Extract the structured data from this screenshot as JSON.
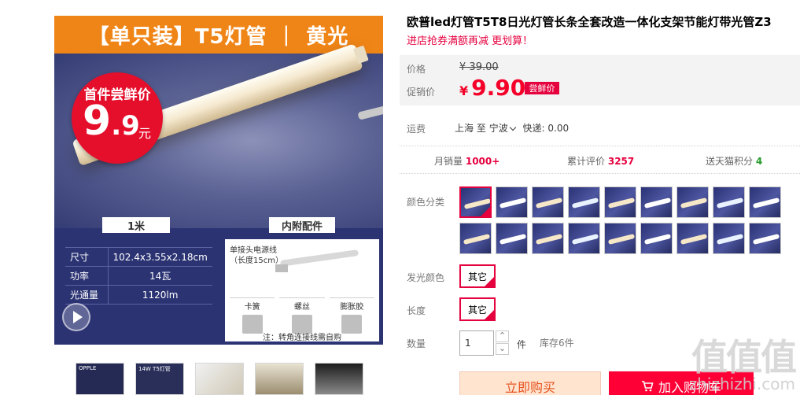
{
  "main_image": {
    "banner_left": "【单只装】T5灯管",
    "banner_sep": "|",
    "banner_right": "黄光",
    "badge_line1": "首件尝鲜价",
    "badge_price_int": "9",
    "badge_price_dec": ".9",
    "badge_unit": "元",
    "length_tag": "1米",
    "accessories_tag": "内附配件",
    "specs": [
      {
        "key": "尺寸",
        "value": "102.4x3.55x2.18cm"
      },
      {
        "key": "功率",
        "value": "14瓦"
      },
      {
        "key": "光通量",
        "value": "1120lm"
      }
    ],
    "accessory_title_1": "单接头电源线",
    "accessory_title_2": "（长度15cm）",
    "accessory_items": [
      "卡簧",
      "螺丝",
      "膨胀胶"
    ],
    "accessory_note": "注：转角连接线需自购"
  },
  "thumbnails": [
    {
      "label": "OPPLE"
    },
    {
      "label": "14W T5灯管"
    },
    {
      "label": ""
    },
    {
      "label": ""
    },
    {
      "label": ""
    }
  ],
  "product": {
    "title": "欧普led灯管T5T8日光灯管长条全套改造一体化支架节能灯带光管Z3",
    "promo": "进店抢券满额再减 更划算！"
  },
  "price": {
    "original_label": "价格",
    "original_currency": "¥",
    "original_value": "39.00",
    "sale_label": "促销价",
    "sale_currency": "¥",
    "sale_value": "9.90",
    "sale_tag": "尝鲜价"
  },
  "shipping": {
    "label": "运费",
    "from": "上海",
    "to_word": "至",
    "to": "宁波",
    "express": "快递: 0.00"
  },
  "stats": {
    "monthly_sales_label": "月销量",
    "monthly_sales_value": "1000+",
    "reviews_label": "累计评价",
    "reviews_value": "3257",
    "points_label": "送天猫积分",
    "points_value": "4"
  },
  "options": {
    "color_label": "颜色分类",
    "color_count": 18,
    "color_selected_index": 0,
    "light_color_label": "发光颜色",
    "light_color_value": "其它",
    "length_label": "长度",
    "length_value": "其它"
  },
  "quantity": {
    "label": "数量",
    "value": "1",
    "unit": "件",
    "stock": "库存6件",
    "up_glyph": "⌃",
    "down_glyph": "⌄"
  },
  "actions": {
    "buy_now": "立即购买",
    "add_to_cart": "加入购物车"
  },
  "watermark": {
    "glyphs": "值值值",
    "text": "zhizhizhi.com"
  },
  "colors": {
    "accent": "#e5003e",
    "price_red": "#f40028",
    "banner_orange": "#f08517",
    "image_navy": "#2b3373"
  }
}
